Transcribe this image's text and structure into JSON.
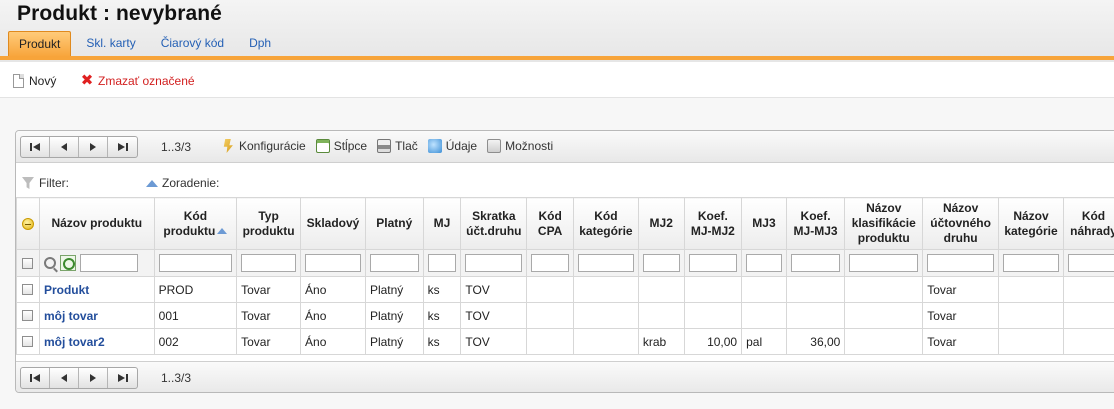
{
  "header": {
    "title": "Produkt :  nevybrané",
    "tabs": [
      {
        "label": "Produkt",
        "active": true
      },
      {
        "label": "Skl. karty",
        "active": false
      },
      {
        "label": "Čiarový kód",
        "active": false
      },
      {
        "label": "Dph",
        "active": false
      }
    ]
  },
  "toolbar": {
    "new_label": "Nový",
    "delete_label": "Zmazať označené"
  },
  "grid": {
    "range_text": "1..3/3",
    "tools": {
      "config": "Konfigurácie",
      "columns": "Stĺpce",
      "print": "Tlač",
      "data": "Údaje",
      "options": "Možnosti"
    },
    "filter_label": "Filter:",
    "sort_label": "Zoradenie:",
    "columns": [
      "Názov produktu",
      "Kód produktu",
      "Typ produktu",
      "Skladový",
      "Platný",
      "MJ",
      "Skratka účt.druhu",
      "Kód CPA",
      "Kód kategórie",
      "MJ2",
      "Koef. MJ-MJ2",
      "MJ3",
      "Koef. MJ-MJ3",
      "Názov klasifikácie produktu",
      "Názov účtovného druhu",
      "Názov kategórie",
      "Kód náhrady"
    ],
    "rows": [
      [
        "Produkt",
        "PROD",
        "Tovar",
        "Áno",
        "Platný",
        "ks",
        "TOV",
        "",
        "",
        "",
        "",
        "",
        "",
        "",
        "Tovar",
        "",
        ""
      ],
      [
        "môj tovar",
        "001",
        "Tovar",
        "Áno",
        "Platný",
        "ks",
        "TOV",
        "",
        "",
        "",
        "",
        "",
        "",
        "",
        "Tovar",
        "",
        ""
      ],
      [
        "môj tovar2",
        "002",
        "Tovar",
        "Áno",
        "Platný",
        "ks",
        "TOV",
        "",
        "",
        "krab",
        "10,00",
        "pal",
        "36,00",
        "",
        "Tovar",
        "",
        ""
      ]
    ]
  },
  "colors": {
    "accent": "#f7a43a",
    "link": "#234e9c",
    "delete": "#d21f1f"
  }
}
